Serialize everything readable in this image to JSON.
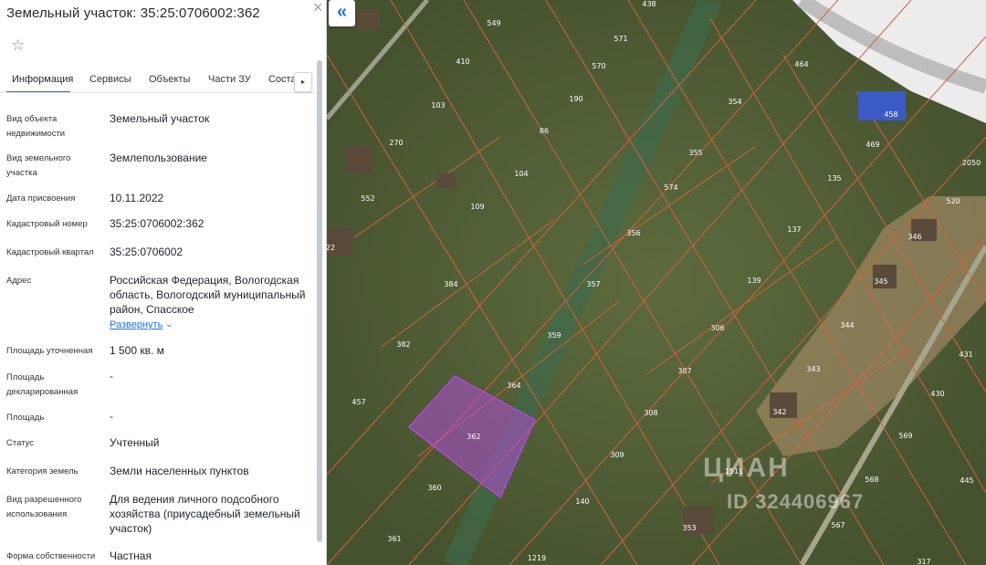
{
  "panel": {
    "title": "Земельный участок: 35:25:0706002:362",
    "close_icon": "×",
    "favorite_icon": "☆",
    "tabs": [
      "Информация",
      "Сервисы",
      "Объекты",
      "Части ЗУ",
      "Соста"
    ],
    "tab_scroll_icon": "▸",
    "properties": [
      {
        "label": "Вид объекта недвижимости",
        "value": "Земельный участок"
      },
      {
        "label": "Вид земельного участка",
        "value": "Землепользование"
      },
      {
        "label": "Дата присвоения",
        "value": "10.11.2022"
      },
      {
        "label": "Кадастровый номер",
        "value": "35:25:0706002:362"
      },
      {
        "label": "Кадастровый квартал",
        "value": "35:25:0706002"
      },
      {
        "label": "Адрес",
        "value": "Российская Федерация, Вологодская область, Вологодский муниципальный район, Спасское"
      },
      {
        "label": "Площадь уточненная",
        "value": "1 500 кв. м"
      },
      {
        "label": "Площадь декларированная",
        "value": "-"
      },
      {
        "label": "Площадь",
        "value": "-"
      },
      {
        "label": "Статус",
        "value": "Учтенный"
      },
      {
        "label": "Категория земель",
        "value": "Земли населенных пунктов"
      },
      {
        "label": "Вид разрешенного использования",
        "value": "Для ведения личного подсобного хозяйства (приусадебный земельный участок)"
      },
      {
        "label": "Форма собственности",
        "value": "Частная"
      }
    ],
    "expand_label": "Развернуть",
    "expand_icon": "⌄"
  },
  "map": {
    "collapse_icon": "«",
    "selected_color": "#b04cd6",
    "boundary_color": "#d9603a",
    "watermark_logo": "ЦИАН",
    "watermark_id": "ID 324406967",
    "plots": [
      "438",
      "549",
      "571",
      "410",
      "570",
      "464",
      "354",
      "190",
      "103",
      "86",
      "458",
      "469",
      "270",
      "355",
      "2050",
      "104",
      "574",
      "135",
      "552",
      "109",
      "520",
      "356",
      "137",
      "346",
      "22",
      "384",
      "357",
      "139",
      "345",
      "344",
      "359",
      "306",
      "431",
      "382",
      "343",
      "364",
      "307",
      "430",
      "457",
      "362",
      "308",
      "342",
      "569",
      "309",
      "1511",
      "568",
      "445",
      "360",
      "140",
      "353",
      "567",
      "361",
      "1219",
      "317"
    ]
  }
}
